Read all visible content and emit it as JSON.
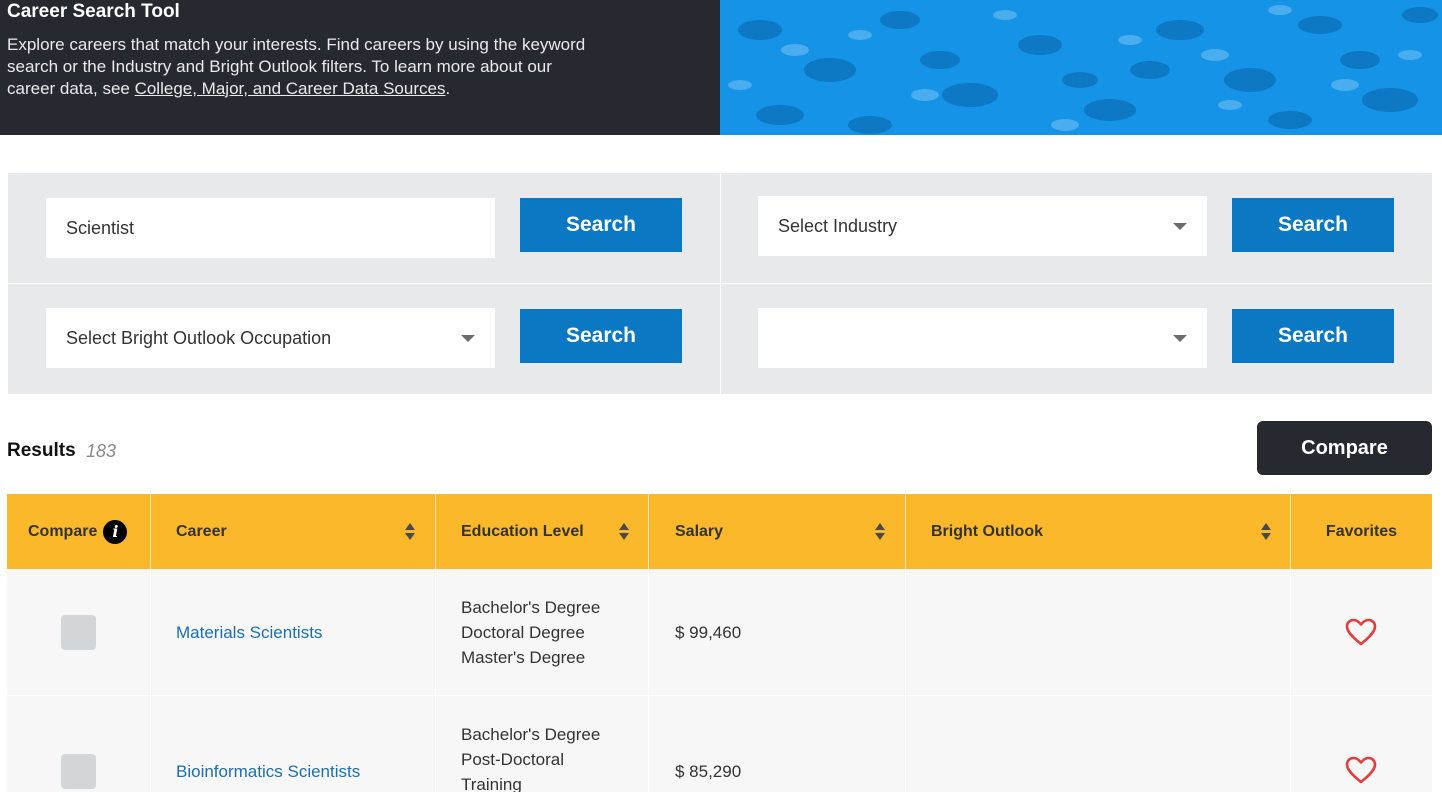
{
  "hero": {
    "title": "Career Search Tool",
    "text_before_link": "Explore careers that match your interests. Find careers by using the keyword search or the Industry and Bright Outlook filters. To learn more about our career data, see ",
    "link_text": "College, Major, and Career Data Sources",
    "text_after_link": "."
  },
  "filters": {
    "keyword_value": "Scientist",
    "industry_selected": "Select Industry",
    "bright_outlook_selected": "Select Bright Outlook Occupation",
    "fourth_selected": "",
    "search_label": "Search"
  },
  "results": {
    "label": "Results",
    "count": "183",
    "compare_button": "Compare"
  },
  "table": {
    "columns": {
      "compare": "Compare",
      "career": "Career",
      "education": "Education Level",
      "salary": "Salary",
      "bright_outlook": "Bright Outlook",
      "favorites": "Favorites"
    },
    "info_icon_glyph": "i",
    "rows": [
      {
        "career": "Materials Scientists",
        "education": [
          "Bachelor's Degree",
          "Doctoral Degree",
          "Master's Degree"
        ],
        "salary": "$ 99,460",
        "bright_outlook": ""
      },
      {
        "career": "Bioinformatics Scientists",
        "education": [
          "Bachelor's Degree",
          "Post-Doctoral",
          "Training"
        ],
        "salary": "$ 85,290",
        "bright_outlook": ""
      }
    ]
  },
  "colors": {
    "hero_dark": "#26292f",
    "hero_blue": "#1593e6",
    "button_blue": "#0a78c3",
    "table_header": "#fbb82a",
    "link_blue": "#1b6fb1",
    "heart_red": "#e43d3d"
  },
  "icons": [
    "info-icon",
    "caret-down-icon",
    "sort-icon",
    "heart-icon"
  ]
}
